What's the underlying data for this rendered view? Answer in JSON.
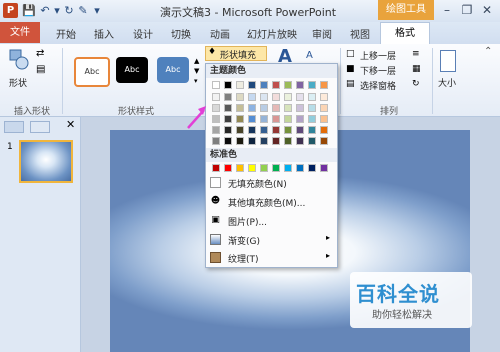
{
  "window": {
    "title": "演示文稿3 - Microsoft PowerPoint",
    "context_tab_group": "绘图工具",
    "logo_letter": "P"
  },
  "tabs": [
    "文件",
    "开始",
    "插入",
    "设计",
    "切换",
    "动画",
    "幻灯片放映",
    "审阅",
    "视图",
    "格式"
  ],
  "ribbon": {
    "insert_shapes": {
      "shapes_label": "形状",
      "group_label": "插入形状"
    },
    "shape_styles": {
      "styles": [
        "Abc",
        "Abc",
        "Abc"
      ],
      "group_label": "形状样式",
      "shape_fill_label": "形状填充"
    },
    "arrange": {
      "bring_forward": "上移一层",
      "send_backward": "下移一层",
      "selection_pane": "选择窗格",
      "group_label": "排列"
    },
    "size": {
      "label": "大小"
    }
  },
  "slides_panel": {
    "slide_number": "1"
  },
  "fill_menu": {
    "theme_colors_heading": "主题颜色",
    "theme_top_row": [
      "#ffffff",
      "#000000",
      "#eeece1",
      "#1f497d",
      "#4f81bd",
      "#c0504d",
      "#9bbb59",
      "#8064a2",
      "#4bacc6",
      "#f79646"
    ],
    "theme_shades": [
      [
        "#f2f2f2",
        "#7f7f7f",
        "#ddd9c3",
        "#c6d9f0",
        "#dbe5f1",
        "#f2dcdb",
        "#ebf1dd",
        "#e5e0ec",
        "#dbeef3",
        "#fdeada"
      ],
      [
        "#d8d8d8",
        "#595959",
        "#c4bd97",
        "#8db3e2",
        "#b8cce4",
        "#e5b9b7",
        "#d7e3bc",
        "#ccc1d9",
        "#b7dde8",
        "#fbd5b5"
      ],
      [
        "#bfbfbf",
        "#3f3f3f",
        "#938953",
        "#548dd4",
        "#95b3d7",
        "#d99694",
        "#c3d69b",
        "#b2a2c7",
        "#92cddc",
        "#fac08f"
      ],
      [
        "#a5a5a5",
        "#262626",
        "#494429",
        "#17365d",
        "#366092",
        "#953734",
        "#76923c",
        "#5f497a",
        "#31859b",
        "#e36c09"
      ],
      [
        "#7f7f7f",
        "#0c0c0c",
        "#1d1b10",
        "#0f243e",
        "#244061",
        "#632423",
        "#4f6128",
        "#3f3151",
        "#205867",
        "#974806"
      ]
    ],
    "standard_colors_heading": "标准色",
    "standard_colors": [
      "#c00000",
      "#ff0000",
      "#ffc000",
      "#ffff00",
      "#92d050",
      "#00b050",
      "#00b0f0",
      "#0070c0",
      "#002060",
      "#7030a0"
    ],
    "no_fill": "无填充颜色(N)",
    "more_colors": "其他填充颜色(M)...",
    "picture": "图片(P)...",
    "gradient": "渐变(G)",
    "texture": "纹理(T)"
  },
  "watermark": {
    "title": "百科全说",
    "subtitle": "助你轻松解决"
  }
}
